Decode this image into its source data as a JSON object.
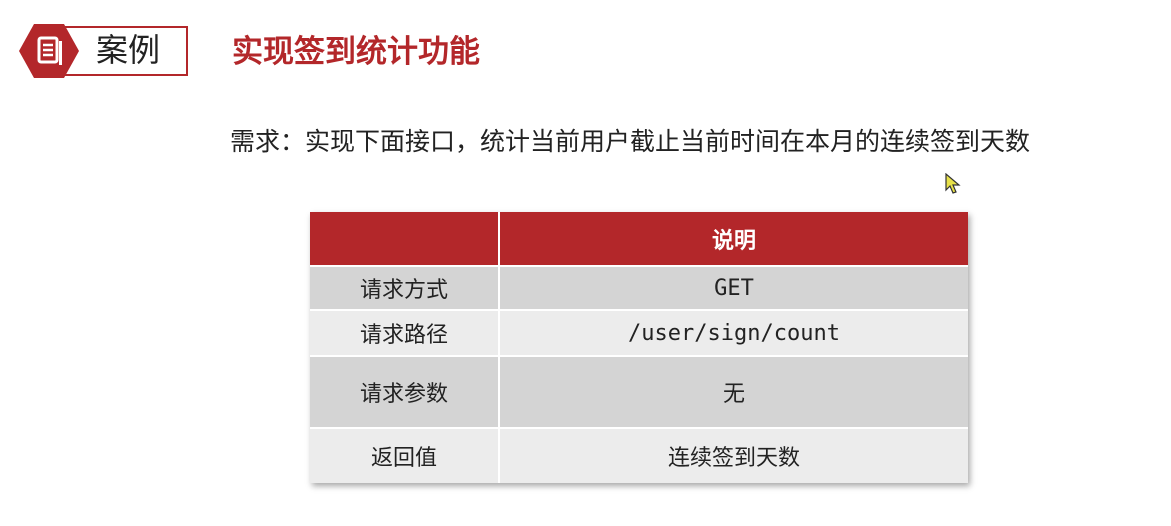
{
  "badge": {
    "label": "案例",
    "icon": "document-icon",
    "color": "#b3272a"
  },
  "title": "实现签到统计功能",
  "requirement": "需求：实现下面接口，统计当前用户截止当前时间在本月的连续签到天数",
  "table": {
    "header": [
      "",
      "说明"
    ],
    "rows": [
      {
        "label": "请求方式",
        "value": "GET"
      },
      {
        "label": "请求路径",
        "value": "/user/sign/count"
      },
      {
        "label": "请求参数",
        "value": "无"
      },
      {
        "label": "返回值",
        "value": "连续签到天数"
      }
    ]
  }
}
